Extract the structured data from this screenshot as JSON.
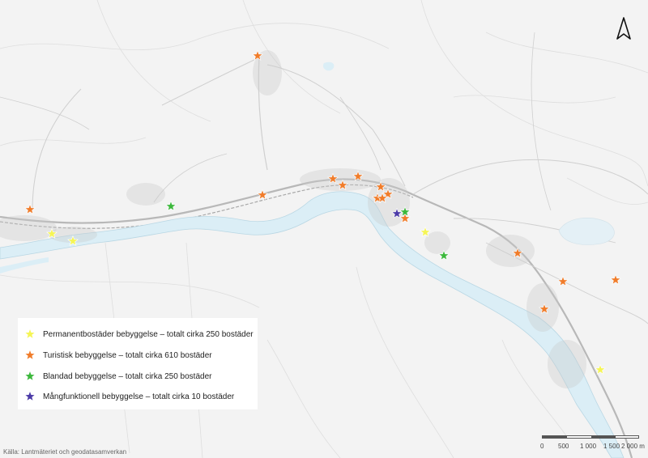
{
  "map": {
    "north_arrow": "north-arrow-icon",
    "colors": {
      "land": "#f3f3f3",
      "water": "#dbeef6",
      "water_edge": "#b9d7e4",
      "road": "#cfcfcf",
      "major_road": "#b8b8b8",
      "rail": "#a8a8a8",
      "settlement": "#c9c9c9"
    },
    "legend": [
      {
        "key": "permanent",
        "label": "Permanentbostäder bebyggelse – totalt cirka 250 bostäder",
        "color": "#f5f555",
        "icon": "yellow-star-icon"
      },
      {
        "key": "tourist",
        "label": "Turistisk bebyggelse – totalt cirka 610 bostäder",
        "color": "#f07c2a",
        "icon": "orange-star-icon"
      },
      {
        "key": "mixed",
        "label": "Blandad bebyggelse – totalt cirka 250 bostäder",
        "color": "#3cb83c",
        "icon": "green-star-icon"
      },
      {
        "key": "multi",
        "label": "Mångfunktionell bebyggelse – totalt cirka 10 bostäder",
        "color": "#4b3aa7",
        "icon": "purple-star-icon"
      }
    ],
    "scale": {
      "labels": [
        "0",
        "500",
        "1 000",
        "1 500",
        "2 000 m"
      ]
    },
    "credit": "Källa: Lantmäteriet och geodatasamverkan"
  }
}
